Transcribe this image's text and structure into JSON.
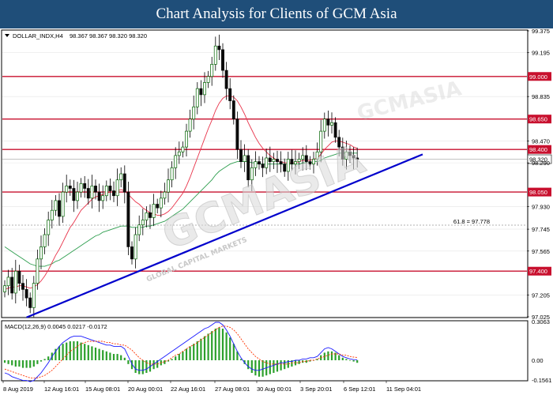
{
  "header": {
    "title": "Chart Analysis for Clients of GCM Asia"
  },
  "colors": {
    "header_bg": "#1f4e79",
    "level_line": "#c8102e",
    "trendline": "#0000cc",
    "ma_fast": "#e8334a",
    "ma_slow": "#2e9e4f",
    "macd_line": "#1a1aff",
    "signal_line": "#ff3300",
    "histogram": "#2ca02c",
    "candle_bull": "#006400",
    "candle_bear": "#0a0a0a"
  },
  "chart_data": {
    "type": "candlestick",
    "symbol_label": "DOLLAR_INDX,H4",
    "ohlc_label": "98.367 98.367 98.320 98.320",
    "ylim": [
      97.025,
      99.375
    ],
    "y_ticks": [
      "99.375",
      "99.195",
      "98.835",
      "98.470",
      "98.290",
      "97.930",
      "97.745",
      "97.565",
      "97.205",
      "97.025"
    ],
    "x_tick_labels": [
      "8 Aug 2019",
      "12 Aug 16:01",
      "15 Aug 08:01",
      "20 Aug 00:01",
      "22 Aug 16:01",
      "27 Aug 08:01",
      "30 Aug 00:01",
      "3 Sep 20:01",
      "6 Sep 12:01",
      "11 Sep 04:01"
    ],
    "levels": [
      {
        "label": "99.000",
        "value": 99.0
      },
      {
        "label": "98.650",
        "value": 98.65
      },
      {
        "label": "98.400",
        "value": 98.4
      },
      {
        "label": "98.050",
        "value": 98.05
      },
      {
        "label": "97.400",
        "value": 97.4
      }
    ],
    "current_price_label": "98.320",
    "current_price": 98.32,
    "fib_label": "61.8 = 97.778",
    "fib_value": 97.778,
    "trendline": {
      "start_index": 7,
      "start_price": 97.02,
      "end_index": 116,
      "end_price": 98.36
    },
    "closes": [
      97.28,
      97.35,
      97.22,
      97.4,
      97.3,
      97.25,
      97.18,
      97.1,
      97.3,
      97.5,
      97.6,
      97.7,
      97.82,
      97.9,
      97.98,
      97.85,
      98.05,
      98.1,
      98.08,
      97.98,
      98.05,
      98.12,
      98.08,
      98.0,
      98.1,
      98.05,
      97.98,
      98.02,
      98.1,
      98.06,
      98.02,
      98.15,
      98.2,
      98.05,
      97.6,
      97.5,
      97.7,
      97.78,
      97.82,
      97.88,
      97.84,
      97.95,
      97.92,
      98.0,
      98.05,
      98.15,
      98.25,
      98.35,
      98.38,
      98.42,
      98.55,
      98.65,
      98.75,
      98.9,
      98.85,
      98.95,
      99.0,
      99.1,
      99.25,
      99.22,
      99.05,
      98.9,
      98.8,
      98.65,
      98.4,
      98.3,
      98.35,
      98.15,
      98.25,
      98.3,
      98.28,
      98.25,
      98.33,
      98.3,
      98.32,
      98.3,
      98.28,
      98.22,
      98.32,
      98.28,
      98.3,
      98.32,
      98.35,
      98.3,
      98.28,
      98.32,
      98.38,
      98.55,
      98.65,
      98.6,
      98.62,
      98.5,
      98.42,
      98.32,
      98.38,
      98.35,
      98.33,
      98.32
    ],
    "ma_fast": [
      97.25,
      97.26,
      97.27,
      97.27,
      97.28,
      97.28,
      97.27,
      97.26,
      97.27,
      97.29,
      97.32,
      97.36,
      97.41,
      97.47,
      97.53,
      97.58,
      97.64,
      97.7,
      97.76,
      97.8,
      97.85,
      97.9,
      97.93,
      97.96,
      97.99,
      98.01,
      98.02,
      98.03,
      98.04,
      98.05,
      98.05,
      98.06,
      98.07,
      98.06,
      98.03,
      98.0,
      97.97,
      97.95,
      97.92,
      97.9,
      97.88,
      97.87,
      97.86,
      97.86,
      97.87,
      97.89,
      97.92,
      97.96,
      98.0,
      98.04,
      98.1,
      98.17,
      98.25,
      98.33,
      98.41,
      98.49,
      98.57,
      98.64,
      98.72,
      98.78,
      98.82,
      98.84,
      98.84,
      98.83,
      98.8,
      98.75,
      98.69,
      98.62,
      98.56,
      98.5,
      98.45,
      98.41,
      98.38,
      98.35,
      98.33,
      98.31,
      98.3,
      98.29,
      98.29,
      98.29,
      98.29,
      98.3,
      98.31,
      98.31,
      98.31,
      98.32,
      98.33,
      98.36,
      98.4,
      98.43,
      98.46,
      98.47,
      98.47,
      98.46,
      98.45,
      98.44,
      98.42,
      98.41
    ],
    "ma_slow": [
      97.6,
      97.58,
      97.56,
      97.54,
      97.52,
      97.5,
      97.48,
      97.46,
      97.45,
      97.44,
      97.44,
      97.44,
      97.45,
      97.46,
      97.48,
      97.49,
      97.51,
      97.53,
      97.55,
      97.57,
      97.59,
      97.61,
      97.63,
      97.65,
      97.67,
      97.69,
      97.7,
      97.72,
      97.73,
      97.74,
      97.75,
      97.76,
      97.77,
      97.77,
      97.77,
      97.76,
      97.76,
      97.76,
      97.76,
      97.77,
      97.77,
      97.78,
      97.79,
      97.8,
      97.81,
      97.83,
      97.85,
      97.87,
      97.89,
      97.91,
      97.94,
      97.97,
      98.0,
      98.03,
      98.06,
      98.09,
      98.12,
      98.15,
      98.19,
      98.22,
      98.24,
      98.26,
      98.28,
      98.29,
      98.3,
      98.3,
      98.3,
      98.3,
      98.29,
      98.29,
      98.28,
      98.28,
      98.28,
      98.28,
      98.28,
      98.28,
      98.28,
      98.28,
      98.28,
      98.28,
      98.28,
      98.28,
      98.29,
      98.29,
      98.29,
      98.3,
      98.3,
      98.31,
      98.33,
      98.34,
      98.35,
      98.36,
      98.37,
      98.37,
      98.37,
      98.37,
      98.37,
      98.37
    ],
    "macd": {
      "label": "MACD(12,26,9) 0.0045 0.0217 -0.0172",
      "params": "12,26,9",
      "values": [
        "0.0045",
        "0.0217",
        "-0.0172"
      ],
      "ylim": [
        -0.1561,
        0.3063
      ],
      "y_ticks": [
        "0.3063",
        "0.00",
        "-0.1561"
      ],
      "histogram": [
        -0.02,
        -0.03,
        -0.04,
        -0.05,
        -0.05,
        -0.06,
        -0.06,
        -0.06,
        -0.05,
        -0.03,
        -0.01,
        0.01,
        0.03,
        0.06,
        0.09,
        0.11,
        0.13,
        0.14,
        0.15,
        0.15,
        0.15,
        0.14,
        0.13,
        0.12,
        0.11,
        0.1,
        0.09,
        0.08,
        0.07,
        0.06,
        0.05,
        0.05,
        0.04,
        0.02,
        -0.03,
        -0.07,
        -0.1,
        -0.11,
        -0.11,
        -0.1,
        -0.09,
        -0.07,
        -0.06,
        -0.04,
        -0.03,
        -0.01,
        0.01,
        0.03,
        0.05,
        0.07,
        0.09,
        0.11,
        0.13,
        0.15,
        0.17,
        0.19,
        0.21,
        0.23,
        0.25,
        0.26,
        0.25,
        0.22,
        0.18,
        0.13,
        0.07,
        0.01,
        -0.03,
        -0.07,
        -0.1,
        -0.12,
        -0.13,
        -0.13,
        -0.12,
        -0.11,
        -0.1,
        -0.09,
        -0.08,
        -0.07,
        -0.06,
        -0.05,
        -0.04,
        -0.03,
        -0.02,
        -0.02,
        -0.01,
        0.0,
        0.01,
        0.04,
        0.06,
        0.07,
        0.07,
        0.06,
        0.04,
        0.02,
        0.01,
        0.0,
        -0.01,
        -0.02
      ],
      "macd_line": [
        -0.1,
        -0.11,
        -0.13,
        -0.14,
        -0.15,
        -0.16,
        -0.16,
        -0.17,
        -0.16,
        -0.13,
        -0.1,
        -0.06,
        -0.02,
        0.03,
        0.07,
        0.11,
        0.14,
        0.16,
        0.18,
        0.19,
        0.19,
        0.19,
        0.18,
        0.17,
        0.16,
        0.15,
        0.14,
        0.13,
        0.12,
        0.12,
        0.11,
        0.11,
        0.11,
        0.09,
        0.03,
        -0.03,
        -0.07,
        -0.08,
        -0.08,
        -0.07,
        -0.05,
        -0.03,
        -0.01,
        0.01,
        0.03,
        0.05,
        0.07,
        0.09,
        0.11,
        0.13,
        0.15,
        0.17,
        0.19,
        0.21,
        0.23,
        0.25,
        0.26,
        0.28,
        0.3,
        0.3,
        0.28,
        0.24,
        0.19,
        0.13,
        0.07,
        0.02,
        -0.02,
        -0.05,
        -0.07,
        -0.08,
        -0.08,
        -0.07,
        -0.06,
        -0.05,
        -0.04,
        -0.03,
        -0.02,
        -0.02,
        -0.01,
        -0.01,
        0.0,
        0.0,
        0.01,
        0.01,
        0.02,
        0.02,
        0.03,
        0.06,
        0.09,
        0.1,
        0.09,
        0.07,
        0.05,
        0.03,
        0.02,
        0.01,
        0.005,
        0.0045
      ],
      "signal_line": [
        -0.07,
        -0.08,
        -0.09,
        -0.1,
        -0.11,
        -0.12,
        -0.13,
        -0.14,
        -0.14,
        -0.14,
        -0.13,
        -0.12,
        -0.1,
        -0.08,
        -0.05,
        -0.02,
        0.01,
        0.04,
        0.07,
        0.09,
        0.11,
        0.13,
        0.14,
        0.15,
        0.15,
        0.15,
        0.15,
        0.15,
        0.14,
        0.14,
        0.13,
        0.13,
        0.12,
        0.12,
        0.1,
        0.08,
        0.05,
        0.02,
        0.0,
        -0.02,
        -0.03,
        -0.03,
        -0.03,
        -0.02,
        -0.01,
        0.0,
        0.02,
        0.04,
        0.05,
        0.07,
        0.09,
        0.11,
        0.12,
        0.14,
        0.16,
        0.18,
        0.2,
        0.22,
        0.24,
        0.26,
        0.27,
        0.27,
        0.26,
        0.24,
        0.21,
        0.17,
        0.13,
        0.09,
        0.06,
        0.03,
        0.01,
        -0.01,
        -0.02,
        -0.03,
        -0.03,
        -0.03,
        -0.03,
        -0.03,
        -0.03,
        -0.02,
        -0.02,
        -0.02,
        -0.01,
        -0.01,
        0.0,
        0.0,
        0.01,
        0.02,
        0.03,
        0.04,
        0.05,
        0.05,
        0.05,
        0.04,
        0.04,
        0.03,
        0.025,
        0.0217
      ]
    }
  },
  "watermark": {
    "main": "GCMASIA",
    "sub": "GLOBAL CAPITAL MARKETS",
    "top_text": "GCMASIA"
  }
}
